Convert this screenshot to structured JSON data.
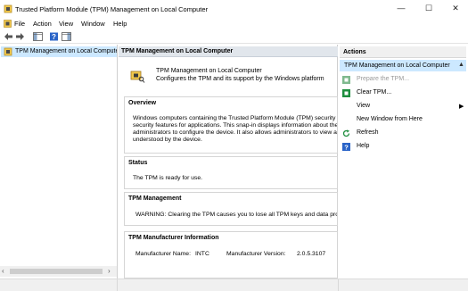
{
  "window": {
    "title": "Trusted Platform Module (TPM) Management on Local Computer",
    "controls": [
      "—",
      "☐",
      "✕"
    ]
  },
  "menu": [
    "File",
    "Action",
    "View",
    "Window",
    "Help"
  ],
  "tree": {
    "selected_label": "TPM Management on Local Computer"
  },
  "center": {
    "header": "TPM Management on Local Computer",
    "intro_title": "TPM Management on Local Computer",
    "intro_desc": "Configures the TPM and its support by the Windows platform",
    "overview": {
      "title": "Overview",
      "lines": [
        "Windows computers containing the Trusted Platform Module (TPM) security ha",
        "security features for applications. This snap-in displays information about the co",
        "administrators to configure the device. It also allows administrators to view and",
        "understood by the device."
      ]
    },
    "status": {
      "title": "Status",
      "text": "The TPM is ready for use."
    },
    "management": {
      "title": "TPM Management",
      "text": "WARNING: Clearing the TPM causes you to lose all TPM keys and data prote"
    },
    "info": {
      "title": "TPM Manufacturer Information",
      "name_label": "Manufacturer Name:",
      "name_value": "INTC",
      "version_label": "Manufacturer Version:",
      "version_value": "2.0.5.3107"
    }
  },
  "actions": {
    "header": "Actions",
    "group_label": "TPM Management on Local Computer",
    "items": [
      {
        "label": "Prepare the TPM...",
        "disabled": true
      },
      {
        "label": "Clear TPM...",
        "disabled": false
      },
      {
        "label": "View",
        "disabled": false
      },
      {
        "label": "New Window from Here",
        "disabled": false
      },
      {
        "label": "Refresh",
        "disabled": false
      },
      {
        "label": "Help",
        "disabled": false
      }
    ]
  },
  "colors": {
    "selection": "#cce8ff",
    "header_band": "#e1e6ec",
    "green": "#1e8e3e",
    "blue": "#2a64c8"
  }
}
